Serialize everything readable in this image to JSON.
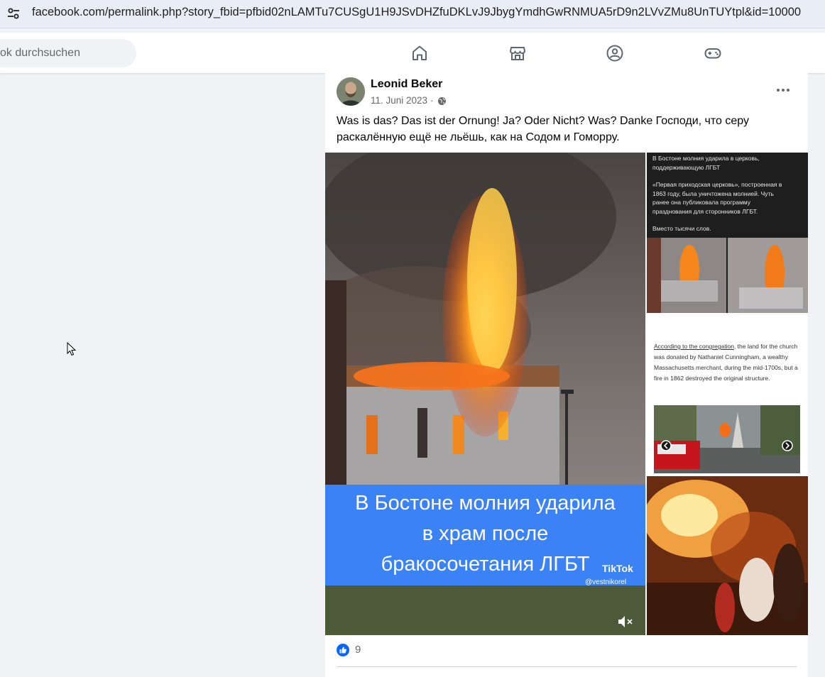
{
  "browser": {
    "url": "facebook.com/permalink.php?story_fbid=pfbid02nLAMTu7CUSgU1H9JSvDHZfuDKLvJ9JbygYmdhGwRNMUA5rD9n2LVvZMu8UnTUYtpl&id=10000"
  },
  "header": {
    "search_placeholder": "ok durchsuchen",
    "nav_icons": [
      "home-icon",
      "marketplace-icon",
      "groups-icon",
      "gaming-icon"
    ]
  },
  "post": {
    "author": "Leonid Beker",
    "date": "11. Juni 2023 ·",
    "text": "Was is das? Das ist der Ornung! Ja? Oder Nicht? Was?  Danke Господи, что серу раскалённую ещё не льёшь, как на Содом и Гоморру.",
    "main_image": {
      "caption_lines": [
        "В Бостоне молния ударила",
        "в храм после",
        "бракосочетания ЛГБТ"
      ],
      "watermark": "TikTok",
      "handle": "@vestnikorel"
    },
    "side_image_1": {
      "lines": [
        "В Бостоне молния ударила в церковь,",
        "поддерживающую ЛГБТ",
        "",
        "«Первая приходская церковь», построенная в",
        "1863 году, была уничтожена молнией. Чуть",
        "ранее она публиковала программу",
        "празднования для сторонников ЛГБТ.",
        "",
        "Вместо тысячи слов."
      ]
    },
    "side_image_2": {
      "link_text": "According to the congregation",
      "text_rest": ", the land for the church was donated by Nathaniel Cunningham, a wealthy Massachusetts merchant, during the mid-1700s, but a fire in 1862 destroyed the original structure."
    },
    "reactions": {
      "like_count": "9"
    }
  },
  "colors": {
    "fb_blue": "#0866ff",
    "caption_blue": "#3b82f6",
    "secondary_text": "#65676b"
  }
}
